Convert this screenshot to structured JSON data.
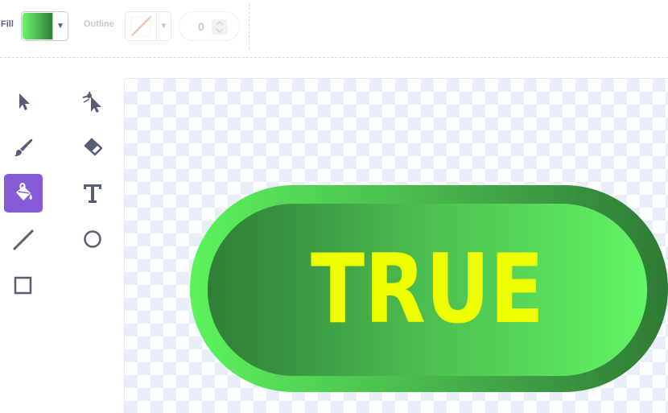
{
  "toolbar": {
    "fill_label": "Fill",
    "outline_label": "Outline",
    "stroke_width": "0",
    "fill_gradient": [
      "#6bf56b",
      "#2f7f38"
    ],
    "outline_color": "none"
  },
  "tools": [
    {
      "name": "select",
      "icon": "arrow-icon",
      "selected": false
    },
    {
      "name": "reshape",
      "icon": "reshape-icon",
      "selected": false
    },
    {
      "name": "brush",
      "icon": "brush-icon",
      "selected": false
    },
    {
      "name": "eraser",
      "icon": "eraser-icon",
      "selected": false
    },
    {
      "name": "fill",
      "icon": "paint-bucket-icon",
      "selected": true
    },
    {
      "name": "text",
      "icon": "text-icon",
      "selected": false
    },
    {
      "name": "line",
      "icon": "line-icon",
      "selected": false
    },
    {
      "name": "circle",
      "icon": "circle-icon",
      "selected": false
    },
    {
      "name": "rectangle",
      "icon": "rectangle-icon",
      "selected": false
    }
  ],
  "canvas": {
    "shape_text": "TRUE",
    "text_color": "#f0ff00",
    "outer_gradient": [
      "#5cf35c",
      "#2e7a34"
    ],
    "inner_gradient": [
      "#2f7d37",
      "#63f563"
    ]
  },
  "colors": {
    "accent": "#855cd6",
    "icon": "#575e75"
  }
}
